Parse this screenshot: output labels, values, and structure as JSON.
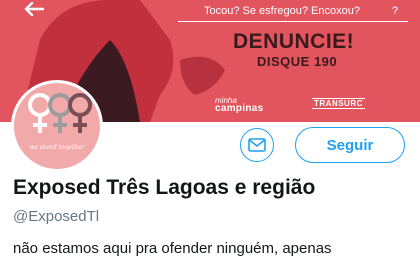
{
  "banner": {
    "tagline_left": "Tocou? Se esfregou? Encoxou?",
    "tagline_right": "?",
    "cta_title": "DENUNCIE!",
    "cta_subtitle": "DISQUE 190",
    "logo_small": "minha",
    "logo_main": "campinas",
    "logo_transit": "TRANSURC",
    "color": "#e2545e"
  },
  "profile": {
    "avatar_caption": "we stand together",
    "name": "Exposed Três Lagoas e região",
    "handle": "@ExposedTl",
    "bio": "não estamos aqui pra ofender ninguém, apenas"
  },
  "actions": {
    "follow_label": "Seguir",
    "accent_color": "#1da1f2"
  },
  "icons": {
    "back": "arrow-left-icon",
    "message": "envelope-icon",
    "avatar_symbols": "female-symbols-icon"
  }
}
